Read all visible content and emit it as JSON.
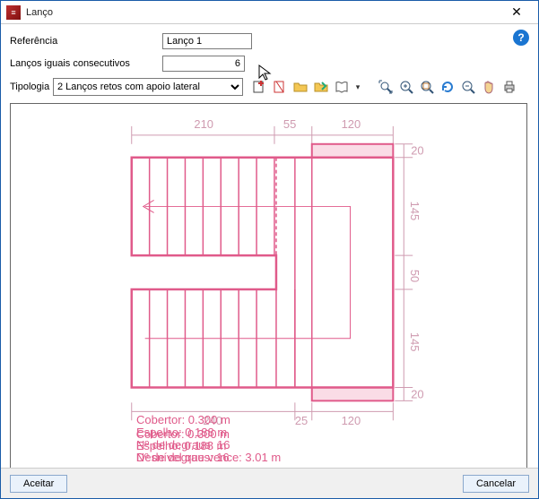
{
  "window": {
    "title": "Lanço",
    "close": "✕"
  },
  "help": "?",
  "form": {
    "ref_label": "Referência",
    "ref_value": "Lanço 1",
    "consec_label": "Lanços iguais consecutivos",
    "consec_value": "6",
    "tipologia_label": "Tipologia",
    "tipologia_value": "2 Lanços retos com apoio lateral"
  },
  "icons": {
    "new": "＋",
    "edit": "✎",
    "open": "📂",
    "save": "➜",
    "book": "📖",
    "dd": "▾",
    "zoomfit": "⤢",
    "zoomin": "⊕",
    "zoomsel": "◯",
    "refresh": "↻",
    "zoomout": "⊖",
    "pan": "✋",
    "print": "🖨"
  },
  "dims": {
    "top1": "210",
    "top2": "55",
    "top3": "120",
    "right1": "20",
    "right2": "145",
    "right3": "50",
    "right4": "145",
    "right5": "20",
    "bot1": "240",
    "bot2": "25",
    "bot3": "120"
  },
  "info": {
    "l1": "Cobertor: 0.300 m",
    "l2": "Espelho: 0.188 m",
    "l3": "Nº de degraus: 16",
    "l4": "Desnível que vence: 3.01 m"
  },
  "buttons": {
    "accept": "Aceitar",
    "cancel": "Cancelar"
  }
}
